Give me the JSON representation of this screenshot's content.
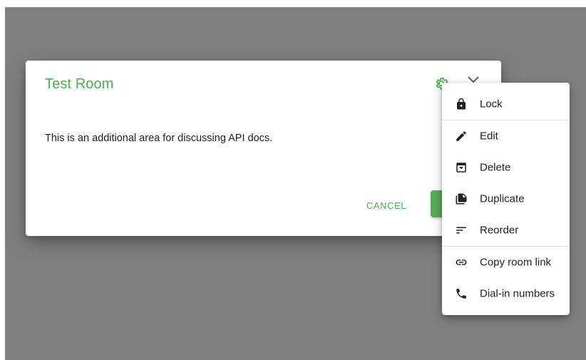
{
  "dialog": {
    "title": "Test Room",
    "description": "This is an additional area for discussing API docs.",
    "cancel_label": "CANCEL"
  },
  "menu": {
    "items": [
      {
        "label": "Lock",
        "icon": "lock-icon"
      },
      {
        "label": "Edit",
        "icon": "pencil-icon"
      },
      {
        "label": "Delete",
        "icon": "archive-icon"
      },
      {
        "label": "Duplicate",
        "icon": "copy-icon"
      },
      {
        "label": "Reorder",
        "icon": "sort-icon"
      },
      {
        "label": "Copy room link",
        "icon": "link-icon"
      },
      {
        "label": "Dial-in numbers",
        "icon": "phone-icon"
      }
    ]
  },
  "colors": {
    "accent": "#4caf50",
    "backdrop": "#808080"
  }
}
